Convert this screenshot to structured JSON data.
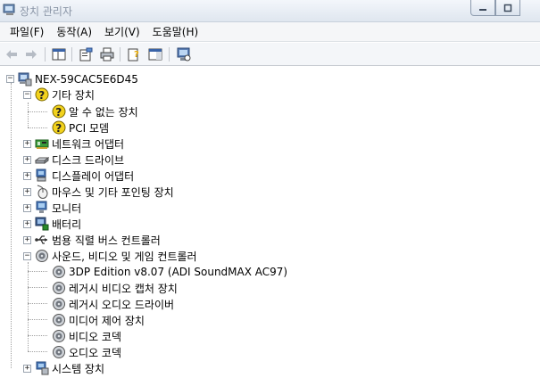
{
  "window": {
    "title": "장치 관리자",
    "controls": [
      "minimize",
      "maximize"
    ]
  },
  "menu": [
    "파일(F)",
    "동작(A)",
    "보기(V)",
    "도움말(H)"
  ],
  "toolbar": [
    "back-arrow-icon",
    "forward-arrow-icon",
    "properties-view-icon",
    "properties-icon",
    "print-icon",
    "help-icon",
    "view-panel-icon",
    "scan-hardware-icon"
  ],
  "tree": {
    "root": "NEX-59CAC5E6D45",
    "categories": [
      {
        "label": "기타 장치",
        "expanded": true,
        "icon": "unknown-device-icon",
        "children": [
          "알 수 없는 장치",
          "PCI 모뎀"
        ]
      },
      {
        "label": "네트워크 어댑터",
        "expanded": false,
        "icon": "network-adapter-icon"
      },
      {
        "label": "디스크 드라이브",
        "expanded": false,
        "icon": "disk-drive-icon"
      },
      {
        "label": "디스플레이 어댑터",
        "expanded": false,
        "icon": "display-adapter-icon"
      },
      {
        "label": "마우스 및 기타 포인팅 장치",
        "expanded": false,
        "icon": "mouse-icon"
      },
      {
        "label": "모니터",
        "expanded": false,
        "icon": "monitor-icon"
      },
      {
        "label": "배터리",
        "expanded": false,
        "icon": "battery-icon"
      },
      {
        "label": "범용 직렬 버스 컨트롤러",
        "expanded": false,
        "icon": "usb-icon"
      },
      {
        "label": "사운드, 비디오 및 게임 컨트롤러",
        "expanded": true,
        "icon": "sound-icon",
        "children": [
          "3DP Edition v8.07 (ADI SoundMAX AC97)",
          "레거시 비디오 캡처 장치",
          "레거시 오디오 드라이버",
          "미디어 제어 장치",
          "비디오 코덱",
          "오디오 코덱"
        ]
      },
      {
        "label": "시스템 장치",
        "expanded": false,
        "icon": "system-device-icon"
      }
    ]
  }
}
